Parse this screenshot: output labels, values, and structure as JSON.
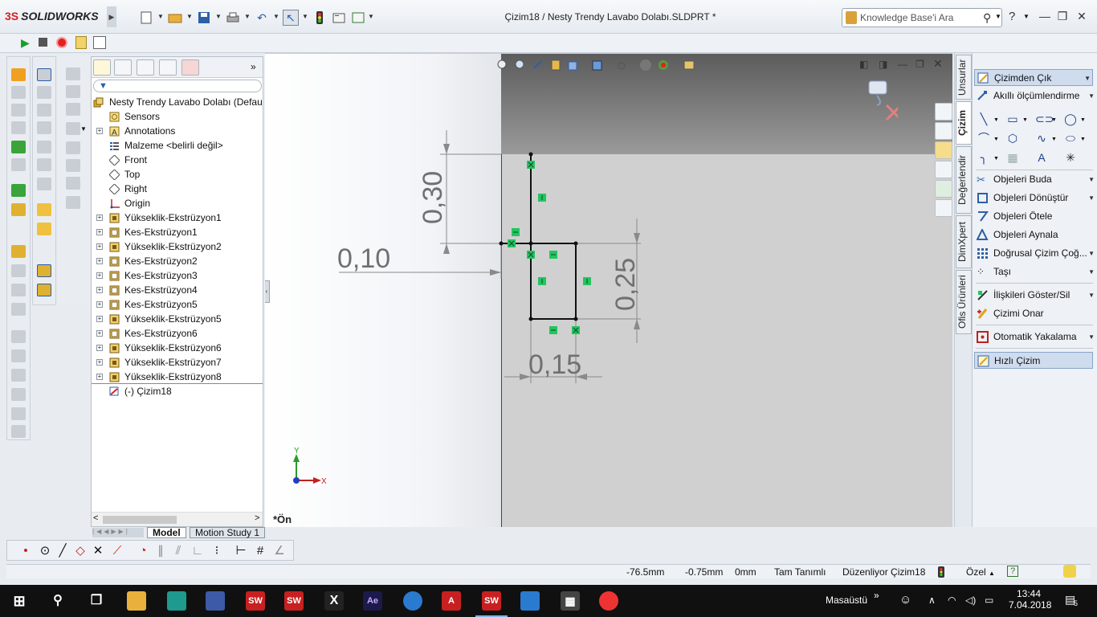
{
  "app": {
    "brand_ds": "3S",
    "brand_name": "SOLIDWORKS",
    "title": "Çizim18 / Nesty Trendy Lavabo Dolabı.SLDPRT *"
  },
  "search": {
    "placeholder": "Knowledge Base'i Ara"
  },
  "feature_tree": {
    "root": "Nesty Trendy Lavabo Dolabı  (Defau",
    "items": [
      {
        "label": "Sensors",
        "icon": "sensor-icon",
        "expandable": false
      },
      {
        "label": "Annotations",
        "icon": "annotation-icon",
        "expandable": true
      },
      {
        "label": "Malzeme <belirli değil>",
        "icon": "material-icon",
        "expandable": false
      },
      {
        "label": "Front",
        "icon": "plane-icon",
        "expandable": false
      },
      {
        "label": "Top",
        "icon": "plane-icon",
        "expandable": false
      },
      {
        "label": "Right",
        "icon": "plane-icon",
        "expandable": false
      },
      {
        "label": "Origin",
        "icon": "origin-icon",
        "expandable": false
      },
      {
        "label": "Yükseklik-Ekstrüzyon1",
        "icon": "boss-extrude-icon",
        "expandable": true
      },
      {
        "label": "Kes-Ekstrüzyon1",
        "icon": "cut-extrude-icon",
        "expandable": true
      },
      {
        "label": "Yükseklik-Ekstrüzyon2",
        "icon": "boss-extrude-icon",
        "expandable": true
      },
      {
        "label": "Kes-Ekstrüzyon2",
        "icon": "cut-extrude-icon",
        "expandable": true
      },
      {
        "label": "Kes-Ekstrüzyon3",
        "icon": "cut-extrude-icon",
        "expandable": true
      },
      {
        "label": "Kes-Ekstrüzyon4",
        "icon": "cut-extrude-icon",
        "expandable": true
      },
      {
        "label": "Kes-Ekstrüzyon5",
        "icon": "cut-extrude-icon",
        "expandable": true
      },
      {
        "label": "Yükseklik-Ekstrüzyon5",
        "icon": "boss-extrude-icon",
        "expandable": true
      },
      {
        "label": "Kes-Ekstrüzyon6",
        "icon": "cut-extrude-icon",
        "expandable": true
      },
      {
        "label": "Yükseklik-Ekstrüzyon6",
        "icon": "boss-extrude-icon",
        "expandable": true
      },
      {
        "label": "Yükseklik-Ekstrüzyon7",
        "icon": "boss-extrude-icon",
        "expandable": true
      },
      {
        "label": "Yükseklik-Ekstrüzyon8",
        "icon": "boss-extrude-icon",
        "expandable": true
      }
    ],
    "active_sketch": "(-) Çizim18"
  },
  "bottom_tabs": [
    "Model",
    "Motion Study 1"
  ],
  "viewport": {
    "view_label": "*Ön",
    "dims": [
      "0,30",
      "0,10",
      "0,25",
      "0,15"
    ],
    "triad_y": "Y",
    "triad_x": "X"
  },
  "cmd_tabs": [
    "Unsurlar",
    "Çizim",
    "Değerlendir",
    "DimXpert",
    "Ofis Ürünleri"
  ],
  "sketch_panel": {
    "exit_sketch": "Çizimden Çık",
    "smart_dim": "Akıllı ölçümlendirme",
    "trim": "Objeleri Buda",
    "convert": "Objeleri Dönüştür",
    "offset": "Objeleri Ötele",
    "mirror": "Objeleri Aynala",
    "linear_pattern": "Doğrusal Çizim Çoğ...",
    "move": "Taşı",
    "relations": "İlişkileri Göster/Sil",
    "repair": "Çizimi Onar",
    "snap": "Otomatik Yakalama",
    "rapid": "Hızlı Çizim"
  },
  "status": {
    "x": "-76.5mm",
    "y": "-0.75mm",
    "z": "0mm",
    "state": "Tam Tanımlı",
    "editing": "Düzenliyor Çizim18",
    "units": "Özel",
    "units_arrow": "▲"
  },
  "taskbar": {
    "desktop_label": "Masaüstü",
    "time": "13:44",
    "date": "7.04.2018",
    "notif_count": "5"
  },
  "colors": {
    "accent": "#2d5fa8",
    "sw_red": "#d12020",
    "relation_green": "#22c55e",
    "taskbar": "#101010"
  }
}
